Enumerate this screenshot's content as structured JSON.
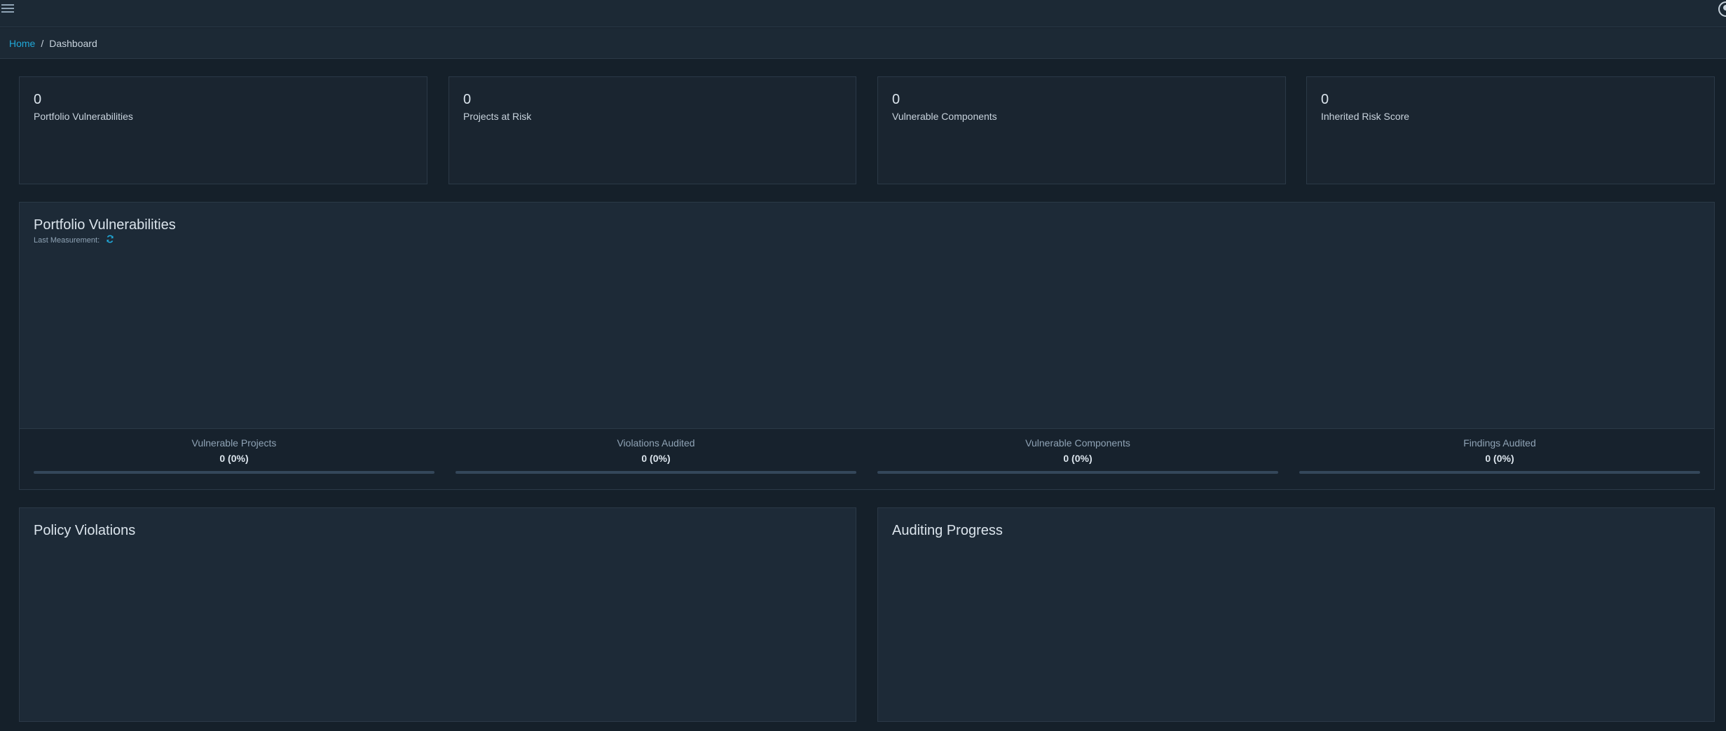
{
  "breadcrumb": {
    "home": "Home",
    "separator": "/",
    "current": "Dashboard"
  },
  "stats": [
    {
      "value": "0",
      "label": "Portfolio Vulnerabilities"
    },
    {
      "value": "0",
      "label": "Projects at Risk"
    },
    {
      "value": "0",
      "label": "Vulnerable Components"
    },
    {
      "value": "0",
      "label": "Inherited Risk Score"
    }
  ],
  "portfolio": {
    "title": "Portfolio Vulnerabilities",
    "last_measurement": "Last Measurement:",
    "metrics": [
      {
        "label": "Vulnerable Projects",
        "value": "0 (0%)",
        "progress": 0
      },
      {
        "label": "Violations Audited",
        "value": "0 (0%)",
        "progress": 0
      },
      {
        "label": "Vulnerable Components",
        "value": "0 (0%)",
        "progress": 0
      },
      {
        "label": "Findings Audited",
        "value": "0 (0%)",
        "progress": 0
      }
    ]
  },
  "policy_violations": {
    "title": "Policy Violations"
  },
  "auditing_progress": {
    "title": "Auditing Progress"
  },
  "icons": {
    "menu": "hamburger-menu-icon",
    "user": "user-circle-icon",
    "refresh": "refresh-icon"
  },
  "colors": {
    "accent": "#20a8d8",
    "background": "#15202a",
    "card": "#1a2530"
  }
}
